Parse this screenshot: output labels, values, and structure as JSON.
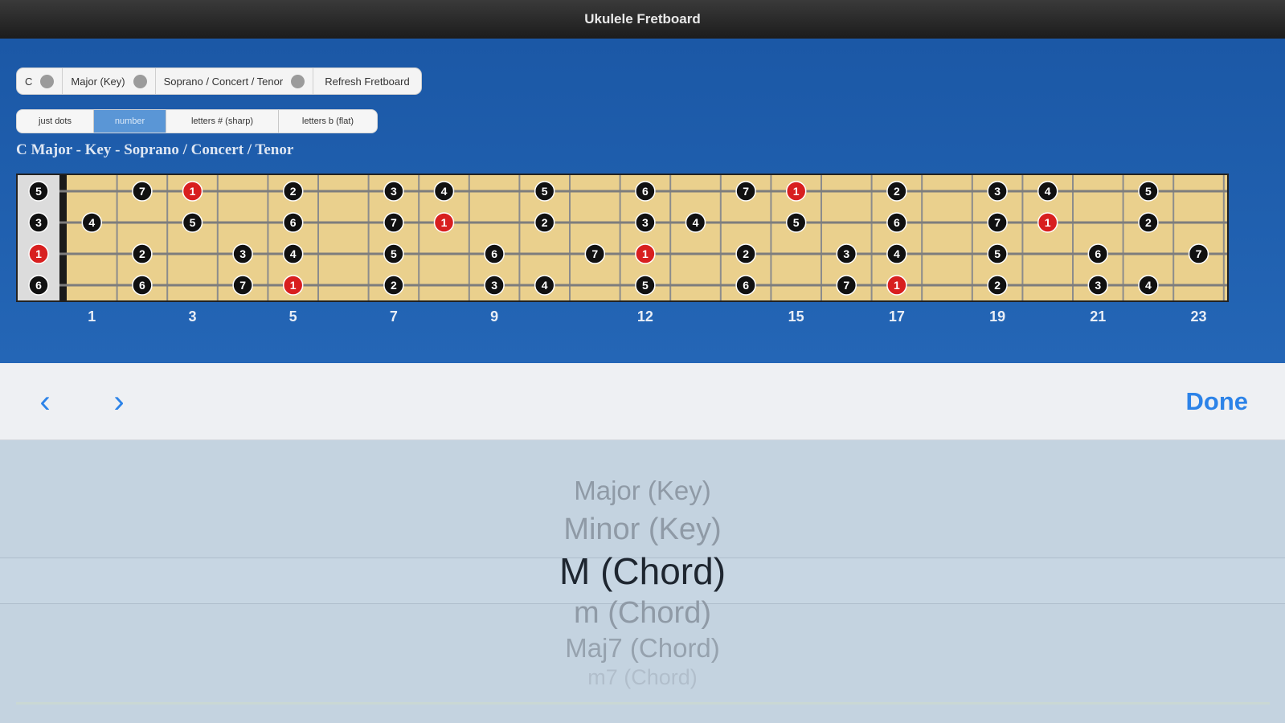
{
  "window": {
    "title": "Ukulele Fretboard"
  },
  "selector_bar": {
    "items": [
      {
        "label": "C",
        "has_dot": true
      },
      {
        "label": "Major (Key)",
        "has_dot": true
      },
      {
        "label": "Soprano / Concert / Tenor",
        "has_dot": true
      },
      {
        "label": "Refresh Fretboard",
        "has_dot": false
      }
    ]
  },
  "mode_bar": {
    "items": [
      {
        "label": "just dots",
        "active": false
      },
      {
        "label": "number",
        "active": true
      },
      {
        "label": "letters # (sharp)",
        "active": false
      },
      {
        "label": "letters b (flat)",
        "active": false
      }
    ]
  },
  "fretboard": {
    "caption": "C Major - Key - Soprano / Concert / Tenor",
    "fret_markers": [
      "1",
      "3",
      "5",
      "7",
      "9",
      "12",
      "15",
      "17",
      "19",
      "21",
      "23"
    ],
    "open_strings": [
      "5",
      "3",
      "1",
      "6"
    ],
    "strings": [
      [
        "",
        "7",
        "1",
        "",
        "2",
        "",
        "3",
        "4",
        "",
        "5",
        "",
        "6",
        "",
        "7",
        "1",
        "",
        "2",
        "",
        "3",
        "4",
        "",
        "5",
        ""
      ],
      [
        "4",
        "",
        "5",
        "",
        "6",
        "",
        "7",
        "1",
        "",
        "2",
        "",
        "3",
        "4",
        "",
        "5",
        "",
        "6",
        "",
        "7",
        "1",
        "",
        "2",
        ""
      ],
      [
        "",
        "2",
        "",
        "3",
        "4",
        "",
        "5",
        "",
        "6",
        "",
        "7",
        "1",
        "",
        "2",
        "",
        "3",
        "4",
        "",
        "5",
        "",
        "6",
        "",
        "7"
      ],
      [
        "",
        "6",
        "",
        "7",
        "1",
        "",
        "2",
        "",
        "3",
        "4",
        "",
        "5",
        "",
        "6",
        "",
        "7",
        "1",
        "",
        "2",
        "",
        "3",
        "4",
        ""
      ]
    ],
    "root_degree": "1",
    "colors": {
      "root": "#d81f1f",
      "note": "#111111",
      "wood": "#ead08d"
    }
  },
  "toolbar": {
    "prev_icon": "chevron-left-icon",
    "next_icon": "chevron-right-icon",
    "prev_glyph": "‹",
    "next_glyph": "›",
    "done_label": "Done",
    "accent": "#2c83e8"
  },
  "picker": {
    "options": [
      "Major (Key)",
      "Minor (Key)",
      "M (Chord)",
      "m (Chord)",
      "Maj7 (Chord)",
      "m7 (Chord)"
    ],
    "selected_index": 2
  }
}
